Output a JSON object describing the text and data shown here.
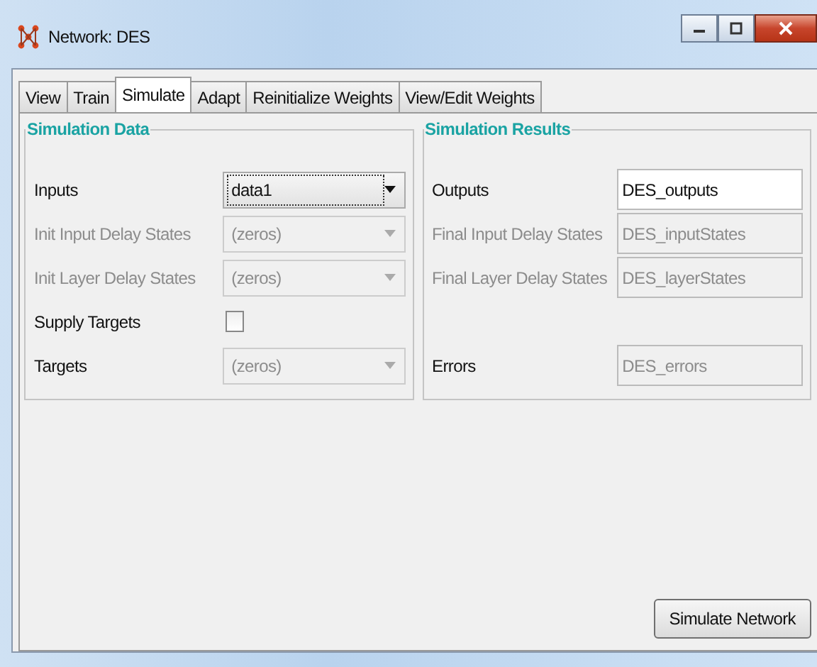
{
  "window": {
    "title": "Network: DES"
  },
  "tabs": [
    {
      "label": "View",
      "selected": false
    },
    {
      "label": "Train",
      "selected": false
    },
    {
      "label": "Simulate",
      "selected": true
    },
    {
      "label": "Adapt",
      "selected": false
    },
    {
      "label": "Reinitialize Weights",
      "selected": false
    },
    {
      "label": "View/Edit Weights",
      "selected": false
    }
  ],
  "simulation_data": {
    "title": "Simulation Data",
    "rows": [
      {
        "kind": "dropdown",
        "label": "Inputs",
        "label_disabled": false,
        "value": "data1",
        "disabled": false,
        "focused": true
      },
      {
        "kind": "dropdown",
        "label": "Init Input Delay States",
        "label_disabled": true,
        "value": "(zeros)",
        "disabled": true,
        "focused": false
      },
      {
        "kind": "dropdown",
        "label": "Init Layer Delay States",
        "label_disabled": true,
        "value": "(zeros)",
        "disabled": true,
        "focused": false
      },
      {
        "kind": "checkbox",
        "label": "Supply Targets",
        "label_disabled": false,
        "checked": false
      },
      {
        "kind": "dropdown",
        "label": "Targets",
        "label_disabled": false,
        "value": "(zeros)",
        "disabled": true,
        "focused": false
      }
    ]
  },
  "simulation_results": {
    "title": "Simulation Results",
    "rows": [
      {
        "label": "Outputs",
        "label_disabled": false,
        "value": "DES_outputs",
        "disabled": false
      },
      {
        "label": "Final Input Delay States",
        "label_disabled": true,
        "value": "DES_inputStates",
        "disabled": true
      },
      {
        "label": "Final Layer Delay States",
        "label_disabled": true,
        "value": "DES_layerStates",
        "disabled": true
      },
      {
        "label": "Errors",
        "label_disabled": false,
        "value": "DES_errors",
        "disabled": true
      }
    ]
  },
  "buttons": [
    "Simulate Network"
  ]
}
